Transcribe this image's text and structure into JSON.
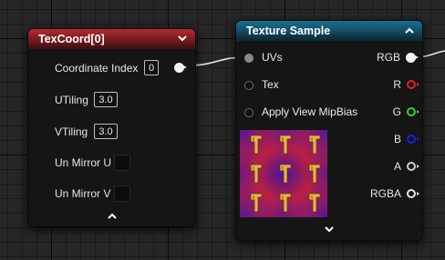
{
  "texcoord_node": {
    "title": "TexCoord[0]",
    "properties": [
      {
        "label": "Coordinate Index",
        "value": "0"
      },
      {
        "label": "UTiling",
        "value": "3.0"
      },
      {
        "label": "VTiling",
        "value": "3.0"
      },
      {
        "label": "Un Mirror U",
        "checked": false
      },
      {
        "label": "Un Mirror V",
        "checked": false
      }
    ]
  },
  "texture_sample_node": {
    "title": "Texture Sample",
    "inputs": [
      {
        "label": "UVs"
      },
      {
        "label": "Tex"
      },
      {
        "label": "Apply View MipBias"
      }
    ],
    "outputs": [
      {
        "label": "RGB",
        "color": "#f2f2f2"
      },
      {
        "label": "R",
        "color": "#e0202a"
      },
      {
        "label": "G",
        "color": "#2ed52e"
      },
      {
        "label": "B",
        "color": "#1f1fd6"
      },
      {
        "label": "A",
        "color": "#cfcfcf"
      },
      {
        "label": "RGBA",
        "color": "#e6e6e6"
      }
    ]
  },
  "colors": {
    "texcoord_header": "#a52a2f",
    "texture_header": "#1a6a8a",
    "canvas": "#262626"
  }
}
